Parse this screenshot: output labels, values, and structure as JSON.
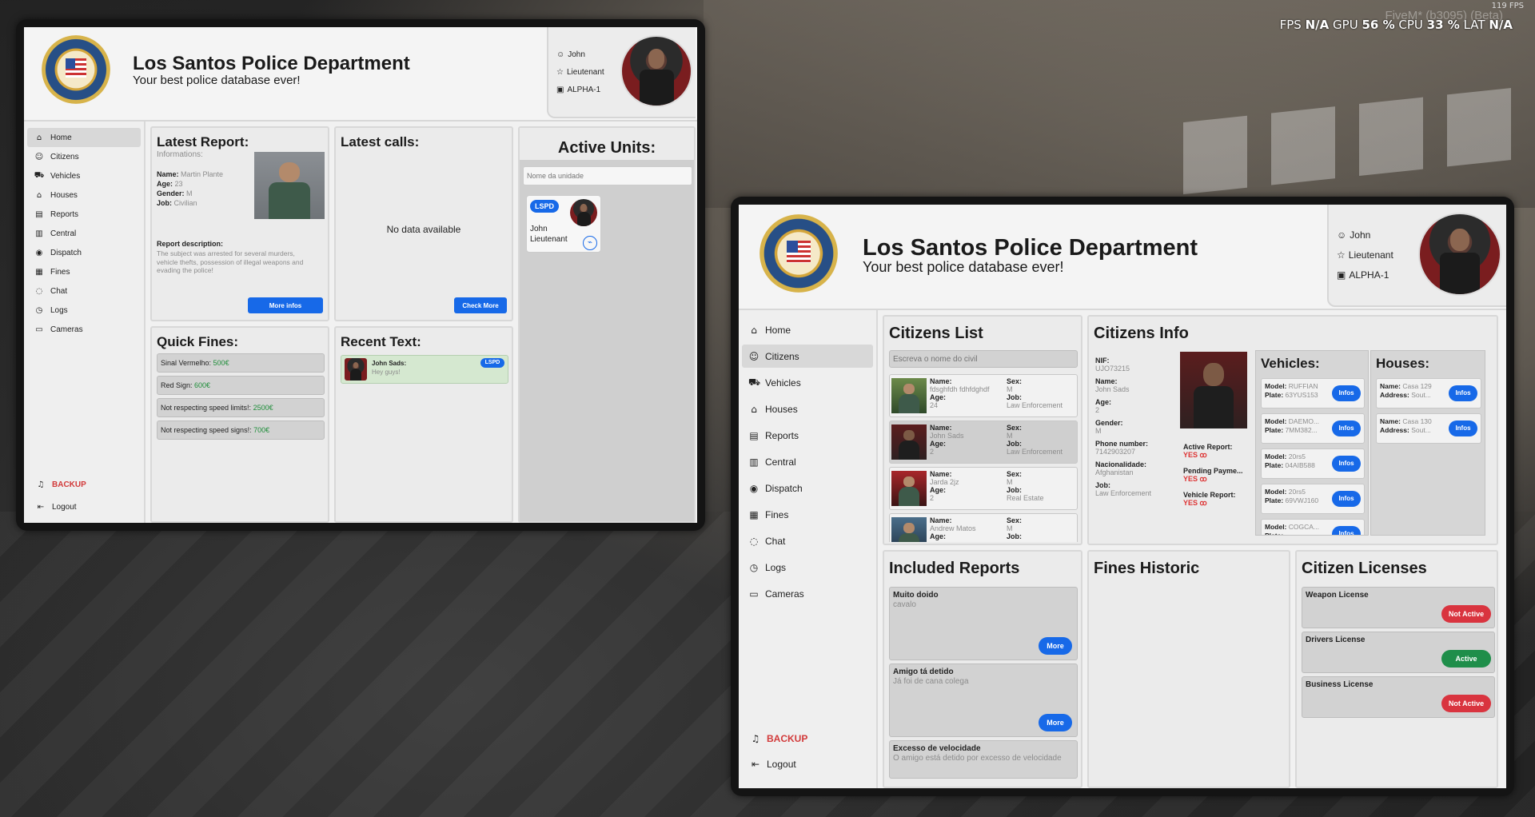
{
  "overlay": {
    "fps_small": "119 FPS",
    "fivem_watermark": "FiveM* (b3095) (Beta)",
    "fps_label": "FPS",
    "fps_value": "N/A",
    "gpu_label": "GPU",
    "gpu_value": "56 %",
    "cpu_label": "CPU",
    "cpu_value": "33 %",
    "lat_label": "LAT",
    "lat_value": "N/A"
  },
  "header": {
    "title": "Los Santos Police Department",
    "subtitle": "Your best police database ever!"
  },
  "profile": {
    "name": "John",
    "rank": "Lieutenant",
    "unit": "ALPHA-1"
  },
  "nav": [
    {
      "label": "Home",
      "icon": "home-icon",
      "glyph": "⌂"
    },
    {
      "label": "Citizens",
      "icon": "user-icon",
      "glyph": "☺"
    },
    {
      "label": "Vehicles",
      "icon": "car-icon",
      "glyph": "⛟"
    },
    {
      "label": "Houses",
      "icon": "house-icon",
      "glyph": "⌂"
    },
    {
      "label": "Reports",
      "icon": "archive-icon",
      "glyph": "▤"
    },
    {
      "label": "Central",
      "icon": "file-icon",
      "glyph": "▥"
    },
    {
      "label": "Dispatch",
      "icon": "map-pin-icon",
      "glyph": "◉"
    },
    {
      "label": "Fines",
      "icon": "document-icon",
      "glyph": "▦"
    },
    {
      "label": "Chat",
      "icon": "chat-icon",
      "glyph": "◌"
    },
    {
      "label": "Logs",
      "icon": "clock-icon",
      "glyph": "◷"
    },
    {
      "label": "Cameras",
      "icon": "camera-icon",
      "glyph": "▭"
    }
  ],
  "nav_backup": "BACKUP",
  "nav_logout": "Logout",
  "left": {
    "latest_report": {
      "title": "Latest Report:",
      "informations": "Informations:",
      "name_label": "Name:",
      "name": "Martin Plante",
      "age_label": "Age:",
      "age": "23",
      "gender_label": "Gender:",
      "gender": "M",
      "job_label": "Job:",
      "job": "Civilian",
      "desc_label": "Report description:",
      "desc": "The subject was arrested for several murders, vehicle thefts, possession of illegal weapons and evading the police!",
      "button": "More infos"
    },
    "latest_calls": {
      "title": "Latest calls:",
      "empty": "No data available",
      "button": "Check More"
    },
    "active_units": {
      "title": "Active Units:",
      "placeholder": "Nome da unidade",
      "unit_badge": "LSPD",
      "unit_name": "John",
      "unit_rank": "Lieutenant"
    },
    "quick_fines": {
      "title": "Quick Fines:",
      "items": [
        {
          "label": "Sinal Vermelho: ",
          "value": "500€"
        },
        {
          "label": "Red Sign: ",
          "value": "600€"
        },
        {
          "label": "Not respecting speed limits!: ",
          "value": "2500€"
        },
        {
          "label": "Not respecting speed signs!: ",
          "value": "700€"
        }
      ]
    },
    "recent_text": {
      "title": "Recent Text:",
      "sender": "John Sads:",
      "message": "Hey guys!",
      "badge": "LSPD"
    }
  },
  "right": {
    "citizens_list": {
      "title": "Citizens List",
      "placeholder": "Escreva o nome do civil",
      "labels": {
        "name": "Name:",
        "age": "Age:",
        "sex": "Sex:",
        "job": "Job:"
      },
      "rows": [
        {
          "name": "fdsghfdh fdhfdghdf",
          "age": "24",
          "sex": "M",
          "job": "Law Enforcement"
        },
        {
          "name": "John Sads",
          "age": "2",
          "sex": "M",
          "job": "Law Enforcement"
        },
        {
          "name": "Jarda 2jz",
          "age": "2",
          "sex": "M",
          "job": "Real Estate"
        },
        {
          "name": "Andrew Matos",
          "age": "",
          "sex": "M",
          "job": ""
        }
      ]
    },
    "citizens_info": {
      "title": "Citizens Info",
      "nif_label": "NIF:",
      "nif": "UJO73215",
      "name_label": "Name:",
      "name": "John Sads",
      "age_label": "Age:",
      "age": "2",
      "gender_label": "Gender:",
      "gender": "M",
      "phone_label": "Phone number:",
      "phone": "7142903207",
      "nation_label": "Nacionalidade:",
      "nation": "Afghanistan",
      "job_label": "Job:",
      "job": "Law Enforcement",
      "active_report_label": "Active Report:",
      "active_report": "YES",
      "pending_label": "Pending Payme...",
      "pending": "YES",
      "vehicle_report_label": "Vehicle Report:",
      "vehicle_report": "YES"
    },
    "vehicles": {
      "title": "Vehicles:",
      "model_label": "Model:",
      "plate_label": "Plate:",
      "button": "Infos",
      "items": [
        {
          "model": "RUFFIAN",
          "plate": "63YUS153"
        },
        {
          "model": "DAEMO...",
          "plate": "7MM382..."
        },
        {
          "model": "20rs5",
          "plate": "04AIB588"
        },
        {
          "model": "20rs5",
          "plate": "69VWJ160"
        },
        {
          "model": "COGCA...",
          "plate": ""
        }
      ]
    },
    "houses": {
      "title": "Houses:",
      "name_label": "Name:",
      "address_label": "Address:",
      "button": "Infos",
      "items": [
        {
          "name": "Casa 129",
          "address": "Sout..."
        },
        {
          "name": "Casa 130",
          "address": "Sout..."
        }
      ]
    },
    "included_reports": {
      "title": "Included Reports",
      "button": "More",
      "items": [
        {
          "title": "Muito doido",
          "desc": "cavalo"
        },
        {
          "title": "Amigo tá detido",
          "desc": "Já foi de cana colega"
        },
        {
          "title": "Excesso de velocidade",
          "desc": "O amigo está detido por excesso de velocidade"
        }
      ]
    },
    "fines_historic": {
      "title": "Fines Historic"
    },
    "licenses": {
      "title": "Citizen Licenses",
      "items": [
        {
          "name": "Weapon License",
          "status": "Not Active",
          "color": "#d9343f"
        },
        {
          "name": "Drivers License",
          "status": "Active",
          "color": "#1f8e4a"
        },
        {
          "name": "Business License",
          "status": "Not Active",
          "color": "#d9343f"
        }
      ]
    }
  }
}
